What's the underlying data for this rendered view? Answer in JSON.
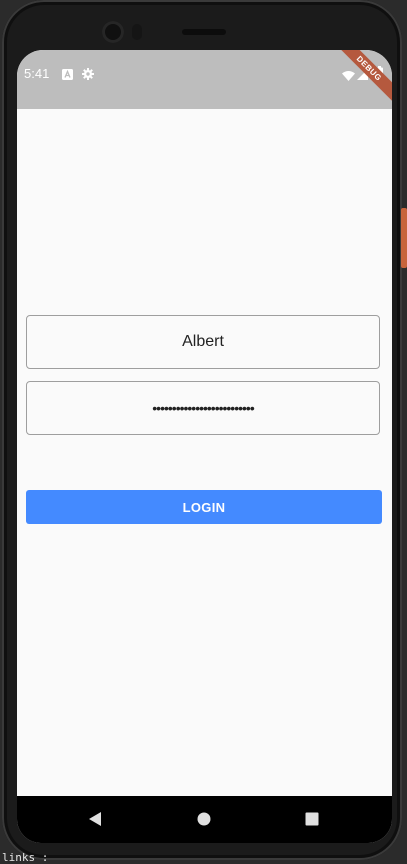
{
  "status_bar": {
    "time": "5:41",
    "icons": [
      "app-notification-icon",
      "settings-icon",
      "wifi-icon",
      "signal-icon",
      "battery-icon"
    ]
  },
  "debug_banner": {
    "label": "DEBUG"
  },
  "form": {
    "username_value": "Albert",
    "password_value": "••••••••••••••••••••••••••"
  },
  "login_button": {
    "label": "LOGIN",
    "color": "#448aff"
  },
  "nav_bar": {
    "icons": [
      "back-icon",
      "home-icon",
      "recents-icon"
    ]
  },
  "footer": {
    "text": "links :"
  }
}
